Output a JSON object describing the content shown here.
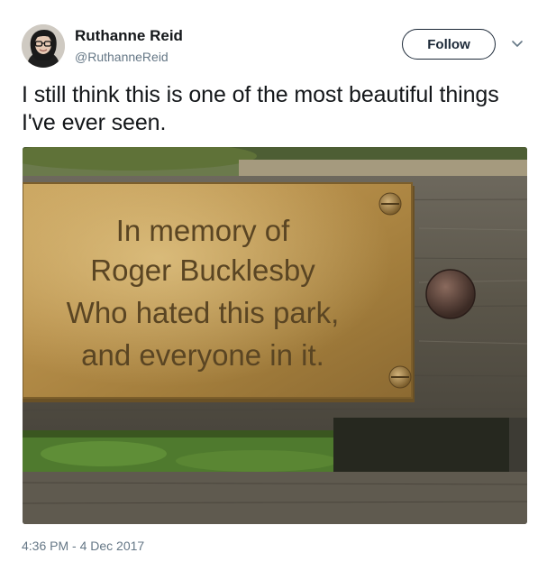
{
  "tweet": {
    "author_name": "Ruthanne Reid",
    "author_handle": "@RuthanneReid",
    "follow_label": "Follow",
    "text": "I still think this is one of the most beautiful things I've ever seen.",
    "timestamp": "4:36 PM - 4 Dec 2017"
  },
  "photo": {
    "plaque_lines": [
      "In memory of",
      "Roger Bucklesby",
      "Who hated this park,",
      "and everyone in it."
    ]
  },
  "icons": {
    "menu_caret": "chevron-down-icon"
  },
  "colors": {
    "text": "#14171a",
    "muted": "#657786",
    "button_border": "#1c2938"
  }
}
